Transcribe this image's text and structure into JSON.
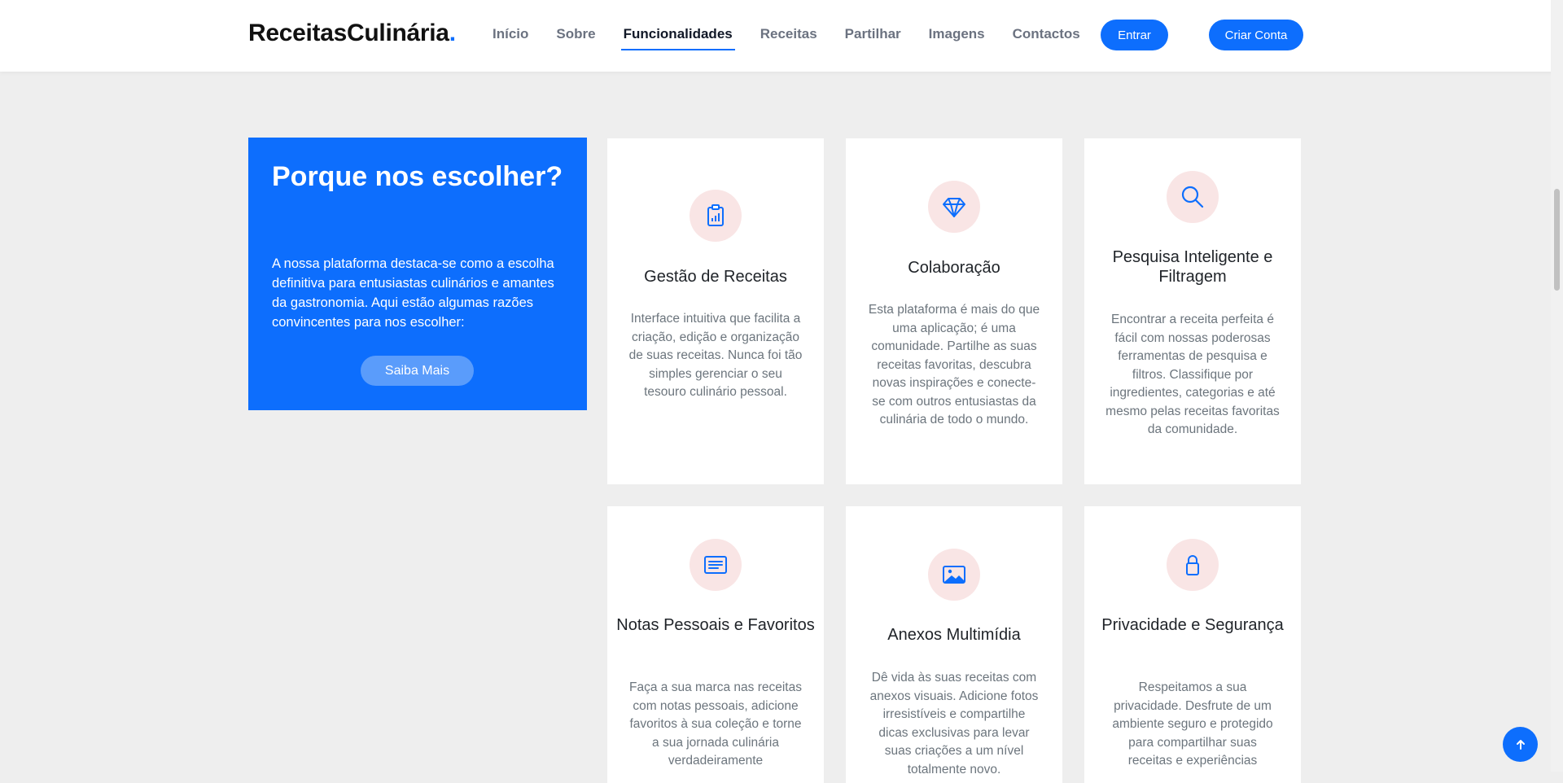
{
  "header": {
    "logo_text": "ReceitasCulinária",
    "logo_dot": ".",
    "nav": [
      {
        "label": "Início"
      },
      {
        "label": "Sobre"
      },
      {
        "label": "Funcionalidades"
      },
      {
        "label": "Receitas"
      },
      {
        "label": "Partilhar"
      },
      {
        "label": "Imagens"
      },
      {
        "label": "Contactos"
      }
    ],
    "active_nav": "Funcionalidades",
    "login_label": "Entrar",
    "signup_label": "Criar Conta"
  },
  "why": {
    "title": "Porque nos escolher?",
    "text": "A nossa plataforma destaca-se como a escolha definitiva para entusiastas culinários e amantes da gastronomia. Aqui estão algumas razões convincentes para nos escolher:",
    "button": "Saiba Mais"
  },
  "features": [
    {
      "icon": "clipboard-chart-icon",
      "title": "Gestão de Receitas",
      "text": "Interface intuitiva que facilita a criação, edição e organização de suas receitas. Nunca foi tão simples gerenciar o seu tesouro culinário pessoal."
    },
    {
      "icon": "gem-icon",
      "title": "Colaboração",
      "text": "Esta plataforma é mais do que uma aplicação; é uma comunidade. Partilhe as suas receitas favoritas, descubra novas inspirações e conecte-se com outros entusiastas da culinária de todo o mundo."
    },
    {
      "icon": "search-icon",
      "title": "Pesquisa Inteligente e Filtragem",
      "text": "Encontrar a receita perfeita é fácil com nossas poderosas ferramentas de pesquisa e filtros. Classifique por ingredientes, categorias e até mesmo pelas receitas favoritas da comunidade."
    },
    {
      "icon": "card-text-icon",
      "title": "Notas Pessoais e Favoritos",
      "text": "Faça a sua marca nas receitas com notas pessoais, adicione favoritos à sua coleção e torne a sua jornada culinária verdadeiramente"
    },
    {
      "icon": "image-icon",
      "title": "Anexos Multimídia",
      "text": "Dê vida às suas receitas com anexos visuais. Adicione fotos irresistíveis e compartilhe dicas exclusivas para levar suas criações a um nível totalmente novo."
    },
    {
      "icon": "lock-icon",
      "title": "Privacidade e Segurança",
      "text": "Respeitamos a sua privacidade. Desfrute de um ambiente seguro e protegido para compartilhar suas receitas e experiências"
    }
  ],
  "colors": {
    "accent": "#0d6efd",
    "icon_bg": "#f9e5e5",
    "page_bg": "#eeeeee"
  }
}
